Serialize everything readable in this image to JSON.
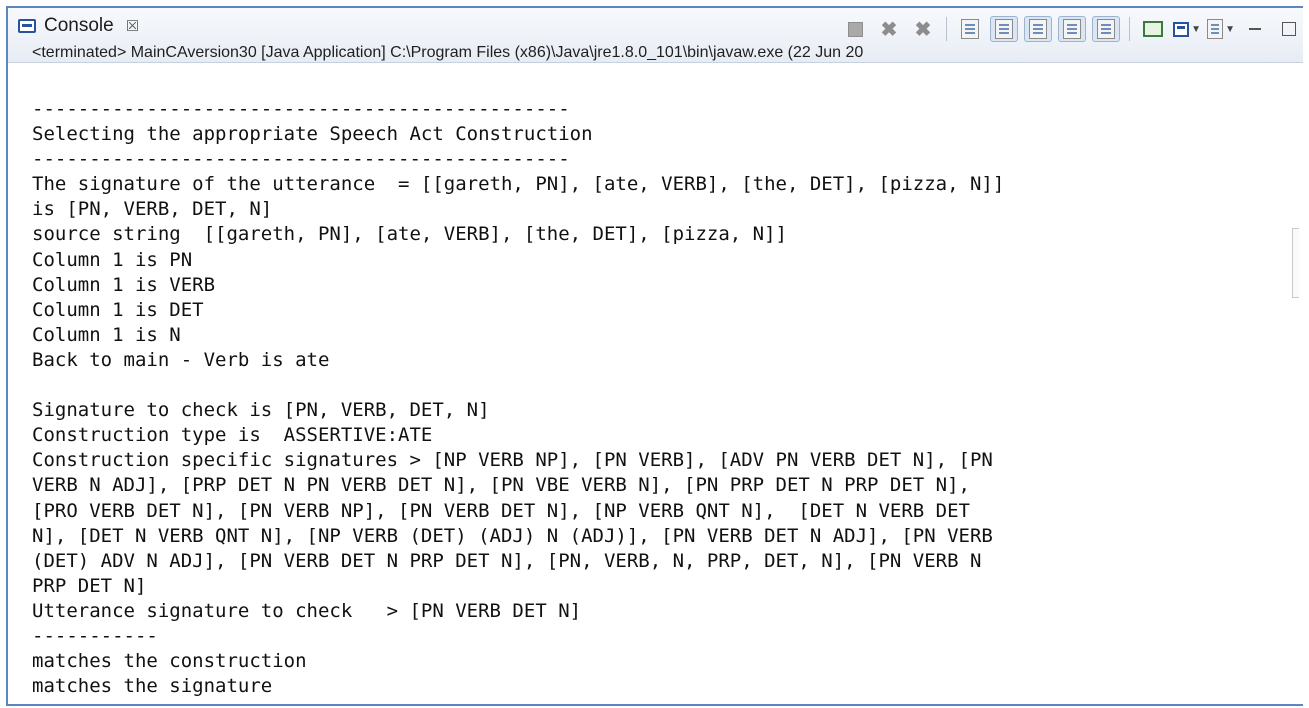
{
  "view": {
    "tab_label": "Console",
    "tab_close_glyph": "☒",
    "status_line": "<terminated> MainCAversion30 [Java Application] C:\\Program Files (x86)\\Java\\jre1.8.0_101\\bin\\javaw.exe (22 Jun 20"
  },
  "toolbar": {
    "buttons": [
      "terminate-icon",
      "remove-launch-icon",
      "remove-all-terminated-icon",
      "clear-console-icon",
      "scroll-lock-icon",
      "word-wrap-icon",
      "show-on-stdout-icon",
      "show-on-stderr-icon",
      "pin-console-icon",
      "display-selected-console-icon",
      "open-console-icon",
      "minimize-icon",
      "maximize-icon"
    ]
  },
  "console": {
    "lines": [
      "-----------------------------------------------",
      "Selecting the appropriate Speech Act Construction",
      "-----------------------------------------------",
      "The signature of the utterance  = [[gareth, PN], [ate, VERB], [the, DET], [pizza, N]]",
      "is [PN, VERB, DET, N]",
      "source string  [[gareth, PN], [ate, VERB], [the, DET], [pizza, N]]",
      "Column 1 is PN",
      "Column 1 is VERB",
      "Column 1 is DET",
      "Column 1 is N",
      "Back to main - Verb is ate",
      "",
      "Signature to check is [PN, VERB, DET, N]",
      "Construction type is  ASSERTIVE:ATE",
      "Construction specific signatures > [NP VERB NP], [PN VERB], [ADV PN VERB DET N], [PN",
      "VERB N ADJ], [PRP DET N PN VERB DET N], [PN VBE VERB N], [PN PRP DET N PRP DET N],",
      "[PRO VERB DET N], [PN VERB NP], [PN VERB DET N], [NP VERB QNT N],  [DET N VERB DET",
      "N], [DET N VERB QNT N], [NP VERB (DET) (ADJ) N (ADJ)], [PN VERB DET N ADJ], [PN VERB",
      "(DET) ADV N ADJ], [PN VERB DET N PRP DET N], [PN, VERB, N, PRP, DET, N], [PN VERB N",
      "PRP DET N]",
      "Utterance signature to check   > [PN VERB DET N]",
      "-----------",
      "matches the construction",
      "matches the signature"
    ]
  }
}
